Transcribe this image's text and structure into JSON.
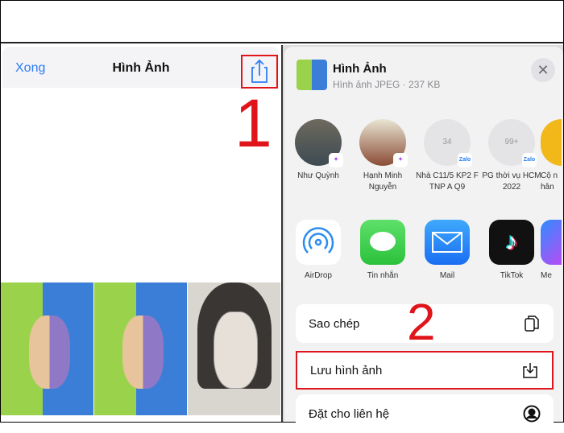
{
  "left": {
    "done_label": "Xong",
    "title": "Hình Ảnh",
    "step_number": "1"
  },
  "sheet": {
    "title": "Hình Ảnh",
    "subtitle": "Hình ảnh JPEG · 237 KB",
    "close_icon": "close-icon",
    "contacts": [
      {
        "name": "Như Quỳnh",
        "badge": "messenger"
      },
      {
        "name": "Hạnh Minh Nguyễn",
        "badge": "messenger"
      },
      {
        "name": "Nhà C11/5 KP2 F TNP A Q9",
        "badge": "Zalo",
        "count": "34"
      },
      {
        "name": "PG thời vụ HCM 2022",
        "badge": "Zalo",
        "count": "99+"
      },
      {
        "name": "Cộ nhân"
      }
    ],
    "apps": [
      {
        "name": "AirDrop"
      },
      {
        "name": "Tin nhắn"
      },
      {
        "name": "Mail"
      },
      {
        "name": "TikTok"
      },
      {
        "name": "Me"
      }
    ],
    "step_number": "2",
    "actions": [
      {
        "label": "Sao chép",
        "icon": "copy-icon"
      },
      {
        "label": "Lưu hình ảnh",
        "icon": "save-icon"
      },
      {
        "label": "Đặt cho liên hệ",
        "icon": "contact-icon"
      }
    ]
  },
  "colors": {
    "accent": "#2f7cf6",
    "highlight": "#e0141b"
  }
}
